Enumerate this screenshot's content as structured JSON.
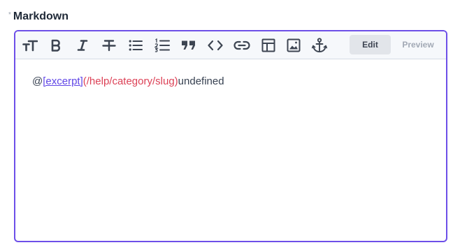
{
  "field": {
    "required_mark": "*",
    "label": "Markdown"
  },
  "toolbar": {
    "tools": [
      {
        "name": "heading",
        "icon": "text-size-icon"
      },
      {
        "name": "bold",
        "icon": "bold-icon"
      },
      {
        "name": "italic",
        "icon": "italic-icon"
      },
      {
        "name": "strikethrough",
        "icon": "strikethrough-icon"
      },
      {
        "name": "unordered-list",
        "icon": "bullet-list-icon"
      },
      {
        "name": "ordered-list",
        "icon": "numbered-list-icon"
      },
      {
        "name": "quote",
        "icon": "quote-icon"
      },
      {
        "name": "code",
        "icon": "code-icon"
      },
      {
        "name": "link",
        "icon": "link-icon"
      },
      {
        "name": "table",
        "icon": "table-icon"
      },
      {
        "name": "image",
        "icon": "image-icon"
      },
      {
        "name": "anchor",
        "icon": "anchor-icon"
      }
    ],
    "modes": {
      "edit_label": "Edit",
      "preview_label": "Preview",
      "active": "Edit"
    }
  },
  "content": {
    "prefix": "@",
    "link_text": "[excerpt]",
    "link_url": "(/help/category/slug)",
    "suffix": "undefined"
  },
  "colors": {
    "focus_border": "#6d4fe8",
    "link_text": "#6046e6",
    "link_url": "#dc4156",
    "toolbar_bg": "#f6f8fb"
  }
}
